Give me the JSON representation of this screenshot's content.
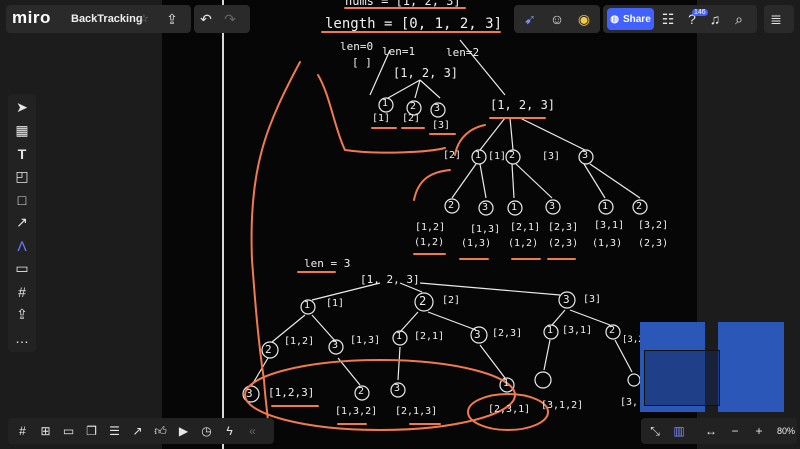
{
  "app": {
    "logo": "miro",
    "board_title": "BackTracking",
    "share_label": "Share",
    "notifications_count": "146",
    "zoom": "80%"
  },
  "board": {
    "header_lines": [
      "nums = [1, 2, 3]",
      "length = [0, 1, 2, 3]"
    ],
    "level_labels": [
      "len=0",
      "len=1",
      "len=2",
      "len = 3"
    ],
    "tree1": {
      "empty": "[ ]",
      "root": "[1, 2, 3]",
      "len1_nodes": [
        "1",
        "2",
        "3"
      ],
      "len1_sets": [
        "[1]",
        "[2]",
        "[3]"
      ],
      "len2_root": "[1, 2, 3]",
      "len2_first": [
        "1",
        "2",
        "3"
      ],
      "len2_first_sets": [
        "[1]",
        "[2]",
        "[3]"
      ],
      "len2_second": [
        "2",
        "3",
        "1",
        "3",
        "1",
        "2"
      ],
      "len2_results": [
        "[1,2]",
        "[1,3]",
        "[2,1]",
        "[2,3]",
        "[3,1]",
        "[3,2]"
      ],
      "len2_results_alt": [
        "(1,2)",
        "(1,3)",
        "(1,2)",
        "(2,3)",
        "(1,3)",
        "(2,3)"
      ]
    },
    "tree2": {
      "root": "[1, 2, 3]",
      "level1": [
        "1",
        "2",
        "3"
      ],
      "level1_sets": [
        "[1]",
        "[2]",
        "[3]"
      ],
      "level2": [
        "2",
        "3",
        "1",
        "3",
        "1",
        "2"
      ],
      "level2_sets": [
        "[1,2]",
        "[1,3]",
        "[2,1]",
        "[2,3]",
        "[3,1]",
        "[3,2]"
      ],
      "level3": [
        "3",
        "2",
        "3",
        "1"
      ],
      "results": [
        "[1,2,3]",
        "[1,3,2]",
        "[2,1,3]",
        "[2,3,1]",
        "[3,1,2]",
        "[3,"
      ]
    }
  },
  "colors": {
    "board_bg": "#060606",
    "annotation": "#f07a50",
    "primary": "#4262ff",
    "minimap": "#2a57b8"
  },
  "icons": {
    "top": [
      "upload-icon",
      "undo-icon",
      "redo-icon",
      "cursor-icon",
      "reactions-icon",
      "timer-icon",
      "globe-icon",
      "settings-sliders-icon",
      "help-icon",
      "bell-icon",
      "search-icon",
      "notes-icon"
    ],
    "left": [
      "select-icon",
      "table-icon",
      "text-icon",
      "sticky-note-icon",
      "shape-icon",
      "arrow-icon",
      "pen-icon",
      "comment-icon",
      "frame-icon",
      "upload-icon",
      "more-icon"
    ],
    "bottom": [
      "frame-icon",
      "present-icon",
      "comment-icon",
      "cards-icon",
      "kanban-icon",
      "share-icon",
      "like-icon",
      "video-icon",
      "timer-icon",
      "lightning-icon",
      "collapse-icon"
    ]
  }
}
